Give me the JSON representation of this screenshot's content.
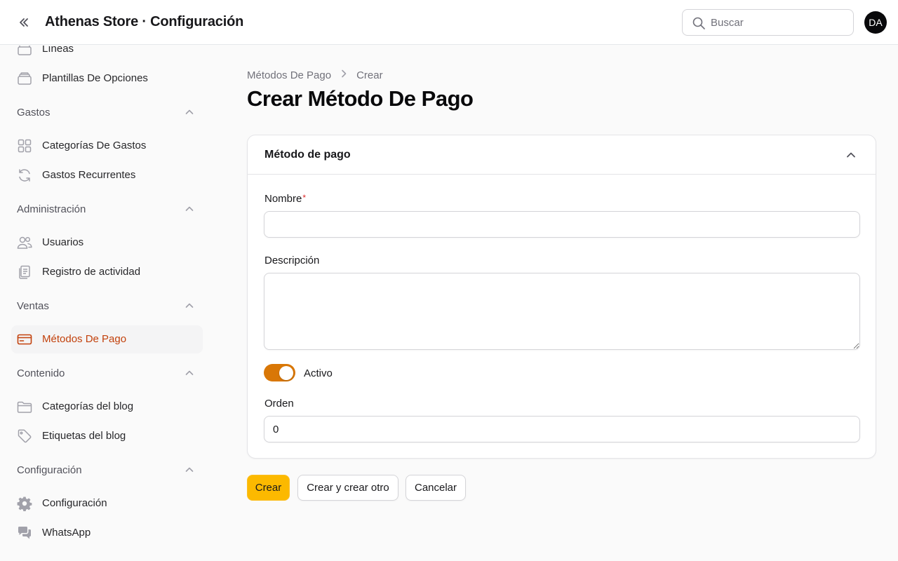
{
  "header": {
    "title": "Athenas Store · Configuración",
    "search_placeholder": "Buscar",
    "avatar_initials": "DA"
  },
  "sidebar": {
    "items_top": [
      {
        "label": "Líneas",
        "icon": "stack-icon"
      },
      {
        "label": "Plantillas De Opciones",
        "icon": "stack-icon"
      }
    ],
    "groups": [
      {
        "label": "Gastos",
        "items": [
          {
            "label": "Categorías De Gastos",
            "icon": "grid-icon"
          },
          {
            "label": "Gastos Recurrentes",
            "icon": "refresh-icon"
          }
        ]
      },
      {
        "label": "Administración",
        "items": [
          {
            "label": "Usuarios",
            "icon": "users-icon"
          },
          {
            "label": "Registro de actividad",
            "icon": "clipboard-icon"
          }
        ]
      },
      {
        "label": "Ventas",
        "items": [
          {
            "label": "Métodos De Pago",
            "icon": "credit-card-icon",
            "active": true
          }
        ]
      },
      {
        "label": "Contenido",
        "items": [
          {
            "label": "Categorías del blog",
            "icon": "folder-icon"
          },
          {
            "label": "Etiquetas del blog",
            "icon": "tag-icon"
          }
        ]
      },
      {
        "label": "Configuración",
        "items": [
          {
            "label": "Configuración",
            "icon": "gear-icon"
          },
          {
            "label": "WhatsApp",
            "icon": "chat-icon"
          }
        ]
      }
    ]
  },
  "breadcrumb": {
    "parent": "Métodos De Pago",
    "current": "Crear"
  },
  "page_title": "Crear Método De Pago",
  "form": {
    "section_title": "Método de pago",
    "nombre_label": "Nombre",
    "required_mark": "*",
    "nombre_value": "",
    "descripcion_label": "Descripción",
    "descripcion_value": "",
    "activo_label": "Activo",
    "activo_on": true,
    "orden_label": "Orden",
    "orden_value": "0"
  },
  "actions": {
    "create": "Crear",
    "create_another": "Crear y crear otro",
    "cancel": "Cancelar"
  },
  "colors": {
    "accent": "#d97706",
    "active_nav_text": "#c2410c",
    "primary_button": "#fcb900"
  }
}
